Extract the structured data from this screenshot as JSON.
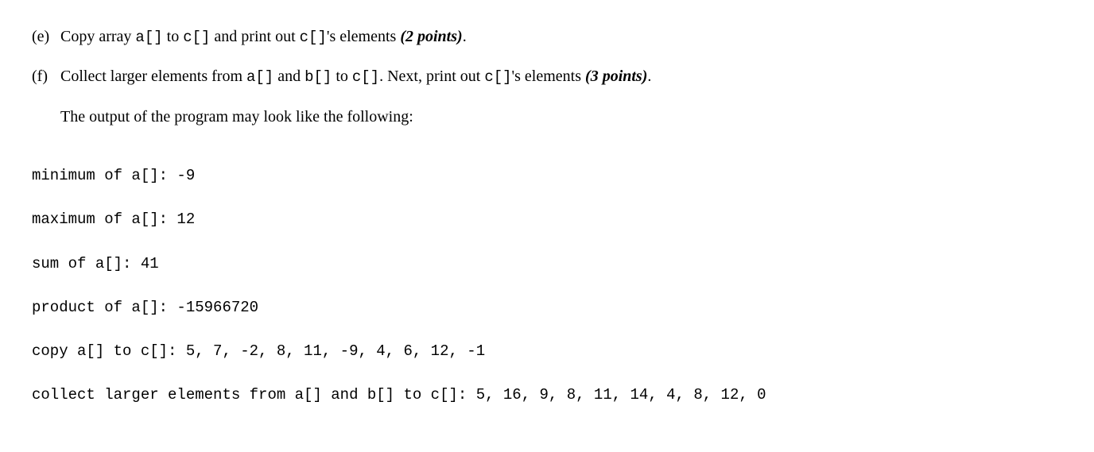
{
  "questions": [
    {
      "label": "(e)",
      "pre1": "Copy array ",
      "code1": "a[]",
      "mid1": " to ",
      "code2": "c[]",
      "mid2": " and print out ",
      "code3": "c[]",
      "post": "'s elements ",
      "points": "(2 points)",
      "end": "."
    },
    {
      "label": "(f)",
      "pre1": "Collect larger elements from ",
      "code1": "a[]",
      "mid1": " and ",
      "code2": "b[]",
      "mid2": " to ",
      "code3": "c[]",
      "mid3": ". Next, print out ",
      "code4": "c[]",
      "post": "'s elements ",
      "points": "(3 points)",
      "end": "."
    }
  ],
  "intro": "The output of the program may look like the following:",
  "output": {
    "lines": [
      "minimum of a[]: -9",
      "maximum of a[]: 12",
      "sum of a[]: 41",
      "product of a[]: -15966720",
      "copy a[] to c[]: 5, 7, -2, 8, 11, -9, 4, 6, 12, -1",
      "collect larger elements from a[] and b[] to c[]: 5, 16, 9, 8, 11, 14, 4, 8, 12, 0"
    ]
  }
}
